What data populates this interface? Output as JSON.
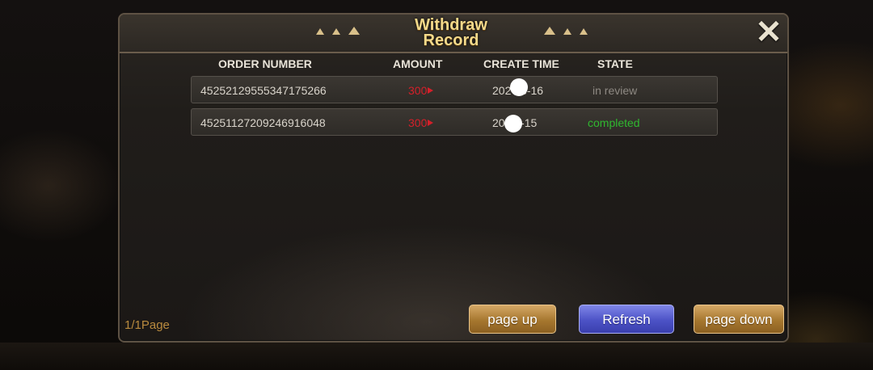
{
  "dialog": {
    "title_line1": "Withdraw",
    "title_line2": "Record"
  },
  "columns": {
    "order_number": "ORDER NUMBER",
    "amount": "AMOUNT",
    "create_time": "CREATE TIME",
    "state": "STATE"
  },
  "records": [
    {
      "order_number": "45252129555347175266",
      "amount": "300",
      "create_time": "202 08-16",
      "state": "in review"
    },
    {
      "order_number": "45251127209246916048",
      "amount": "300",
      "create_time": "20 08-15",
      "state": "completed"
    }
  ],
  "footer": {
    "page_indicator": "1/1Page",
    "page_up_label": "page up",
    "refresh_label": "Refresh",
    "page_down_label": "page down"
  },
  "colors": {
    "title": "#f3d98a",
    "amount": "#d4202a",
    "state_in_review": "#8e8983",
    "state_completed": "#2fb82f",
    "gold_button": "#b8863c",
    "blue_button": "#5a60d2",
    "page_indicator": "#b98a3e"
  },
  "icons": {
    "close": "close-icon",
    "currency": "currency-icon",
    "decoration": "spade-ornament-icon"
  }
}
